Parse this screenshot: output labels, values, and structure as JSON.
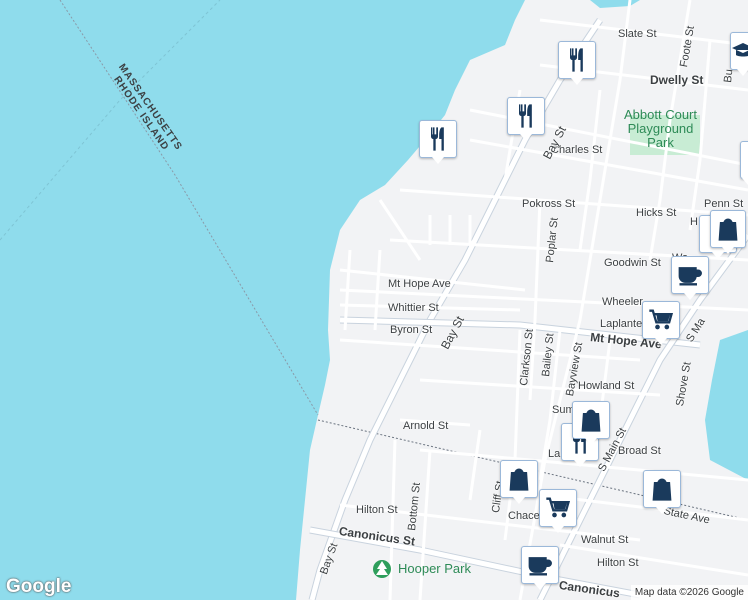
{
  "map": {
    "border_label": "MASSACHUSETTS\nRHODE ISLAND",
    "streets": {
      "slate_st": "Slate St",
      "foote_st": "Foote St",
      "dwelly_st": "Dwelly St",
      "charles_st": "Charles St",
      "bay_st_upper": "Bay St",
      "pokross_st": "Pokross St",
      "hicks_st": "Hicks St",
      "penn_st": "Penn St",
      "poplar_st": "Poplar St",
      "goodwin_st": "Goodwin St",
      "mt_hope_ave": "Mt Hope Ave",
      "whittier_st": "Whittier St",
      "wheeler": "Wheeler",
      "byron_st": "Byron St",
      "bay_st_mid": "Bay St",
      "laplante": "Laplante",
      "mt_hope_ave_main": "Mt Hope Ave",
      "clarkson_st": "Clarkson St",
      "bailey_st": "Bailey St",
      "bayview_st": "Bayview St",
      "howland_st": "Howland St",
      "shove_st": "Shove St",
      "arnold_st": "Arnold St",
      "broad_st": "Broad St",
      "s_main": "S Ma",
      "hilton_st": "Hilton St",
      "bottom_st": "Bottom St",
      "cliff_st": "Cliff St",
      "chace": "Chace",
      "walnut_st": "Walnut St",
      "state_ave": "State Ave",
      "hilton_st_2": "Hilton St",
      "canonicus_st": "Canonicus St",
      "canonicus_st_2": "Canonicus",
      "bay_st_lower": "Bay St",
      "sum": "Sum",
      "la": "La",
      "wa": "Wa",
      "s_main_2": "S Main St",
      "bu": "Bu",
      "h": "H"
    },
    "parks": {
      "abbott": "Abbott Court\nPlayground\nPark",
      "hooper": "Hooper Park"
    },
    "markers": [
      {
        "type": "restaurant",
        "icon": "fork-knife-icon"
      },
      {
        "type": "restaurant",
        "icon": "fork-knife-icon"
      },
      {
        "type": "restaurant",
        "icon": "fork-knife-icon"
      },
      {
        "type": "restaurant",
        "icon": "fork-knife-icon"
      },
      {
        "type": "restaurant",
        "icon": "fork-knife-icon"
      },
      {
        "type": "cafe",
        "icon": "coffee-cup-icon"
      },
      {
        "type": "grocery",
        "icon": "shopping-cart-icon"
      },
      {
        "type": "shopping",
        "icon": "shopping-bag-icon"
      },
      {
        "type": "shopping",
        "icon": "shopping-bag-icon"
      },
      {
        "type": "shopping",
        "icon": "shopping-bag-icon"
      },
      {
        "type": "grocery",
        "icon": "shopping-cart-icon"
      },
      {
        "type": "cafe",
        "icon": "coffee-cup-icon"
      },
      {
        "type": "school",
        "icon": "graduation-cap-icon"
      }
    ],
    "google_logo": "Google",
    "attribution": "Map data ©2026 Google",
    "colors": {
      "water": "#8fdcec",
      "land": "#f2f3f5",
      "road": "#ffffff",
      "main_road": "#c9d3de",
      "marker_icon": "#1a3a5c",
      "park": "#c8ecd4"
    }
  }
}
